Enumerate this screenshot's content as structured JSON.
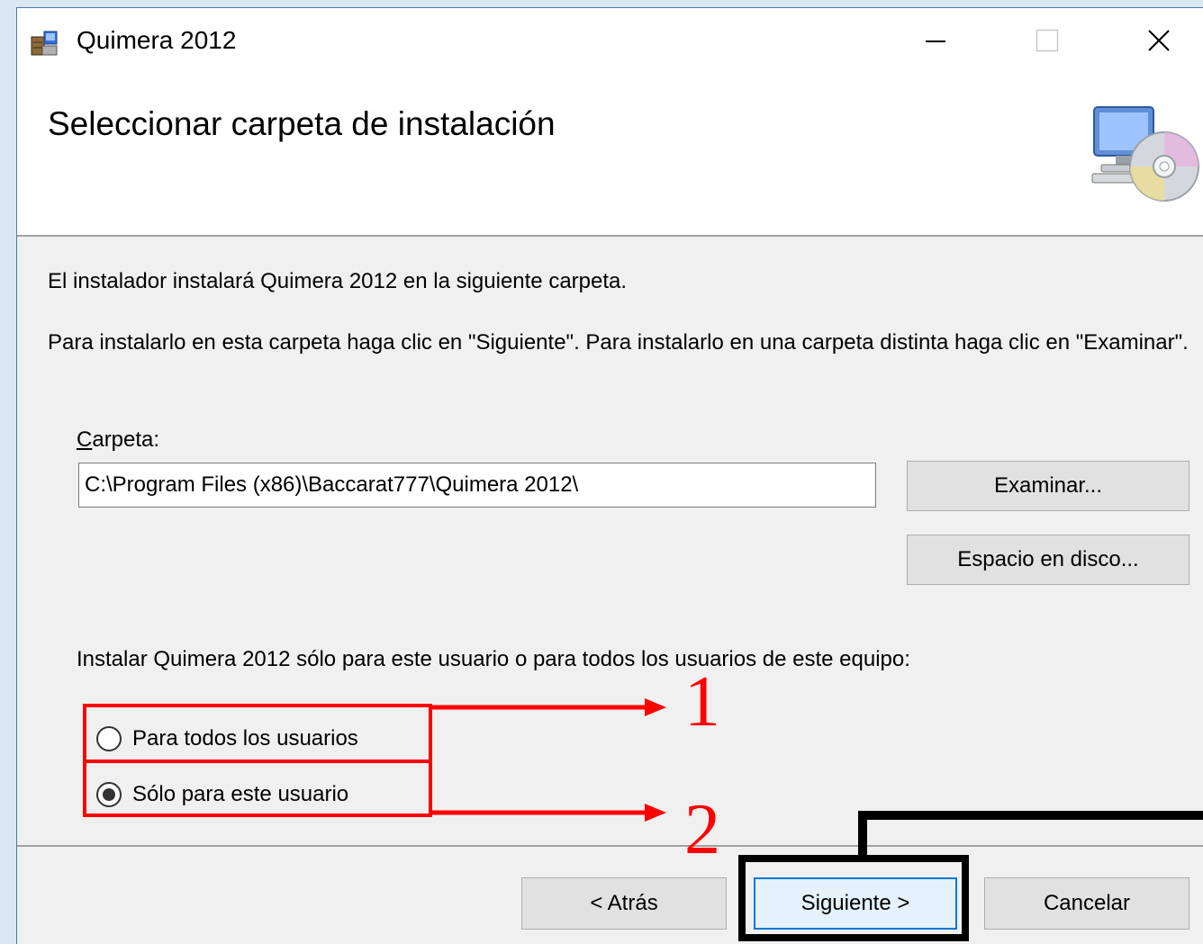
{
  "window": {
    "title": "Quimera 2012",
    "controls": {
      "minimize": "minimize-icon",
      "maximize": "maximize-icon",
      "close": "close-icon"
    }
  },
  "header": {
    "heading": "Seleccionar carpeta de instalación",
    "icon": "computer-disc-icon"
  },
  "body": {
    "intro": "El instalador instalará Quimera 2012 en la siguiente carpeta.",
    "instructions": "Para instalarlo en esta carpeta haga clic en \"Siguiente\". Para instalarlo en una carpeta distinta haga clic en \"Examinar\".",
    "folder_label_accel": "C",
    "folder_label_rest": "arpeta:",
    "folder_value": "C:\\Program Files (x86)\\Baccarat777\\Quimera 2012\\",
    "browse_button": "Examinar...",
    "disk_space_button": "Espacio en disco...",
    "scope_question": "Instalar Quimera 2012 sólo para este usuario o para todos los usuarios de este equipo:",
    "scope_options": [
      {
        "label": "Para todos los usuarios",
        "checked": false
      },
      {
        "label": "Sólo para este usuario",
        "checked": true
      }
    ]
  },
  "footer": {
    "back_button": "< Atrás",
    "next_button": "Siguiente >",
    "cancel_button": "Cancelar"
  },
  "annotations": {
    "labels": [
      "1",
      "2"
    ],
    "highlight_color": "#ff0000",
    "callout_color": "#000000"
  },
  "colors": {
    "accent": "#0078d7",
    "dialog_bg": "#f0f0f0",
    "button_bg": "#e1e1e1"
  }
}
